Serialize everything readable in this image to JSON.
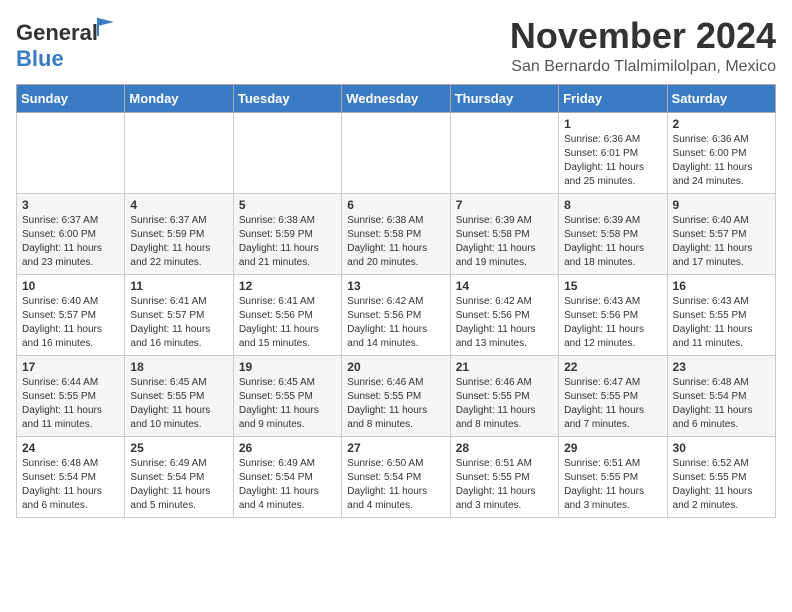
{
  "logo": {
    "general": "General",
    "blue": "Blue"
  },
  "title": "November 2024",
  "location": "San Bernardo Tlalmimilolpan, Mexico",
  "days_of_week": [
    "Sunday",
    "Monday",
    "Tuesday",
    "Wednesday",
    "Thursday",
    "Friday",
    "Saturday"
  ],
  "weeks": [
    [
      {
        "day": "",
        "info": ""
      },
      {
        "day": "",
        "info": ""
      },
      {
        "day": "",
        "info": ""
      },
      {
        "day": "",
        "info": ""
      },
      {
        "day": "",
        "info": ""
      },
      {
        "day": "1",
        "info": "Sunrise: 6:36 AM\nSunset: 6:01 PM\nDaylight: 11 hours and 25 minutes."
      },
      {
        "day": "2",
        "info": "Sunrise: 6:36 AM\nSunset: 6:00 PM\nDaylight: 11 hours and 24 minutes."
      }
    ],
    [
      {
        "day": "3",
        "info": "Sunrise: 6:37 AM\nSunset: 6:00 PM\nDaylight: 11 hours and 23 minutes."
      },
      {
        "day": "4",
        "info": "Sunrise: 6:37 AM\nSunset: 5:59 PM\nDaylight: 11 hours and 22 minutes."
      },
      {
        "day": "5",
        "info": "Sunrise: 6:38 AM\nSunset: 5:59 PM\nDaylight: 11 hours and 21 minutes."
      },
      {
        "day": "6",
        "info": "Sunrise: 6:38 AM\nSunset: 5:58 PM\nDaylight: 11 hours and 20 minutes."
      },
      {
        "day": "7",
        "info": "Sunrise: 6:39 AM\nSunset: 5:58 PM\nDaylight: 11 hours and 19 minutes."
      },
      {
        "day": "8",
        "info": "Sunrise: 6:39 AM\nSunset: 5:58 PM\nDaylight: 11 hours and 18 minutes."
      },
      {
        "day": "9",
        "info": "Sunrise: 6:40 AM\nSunset: 5:57 PM\nDaylight: 11 hours and 17 minutes."
      }
    ],
    [
      {
        "day": "10",
        "info": "Sunrise: 6:40 AM\nSunset: 5:57 PM\nDaylight: 11 hours and 16 minutes."
      },
      {
        "day": "11",
        "info": "Sunrise: 6:41 AM\nSunset: 5:57 PM\nDaylight: 11 hours and 16 minutes."
      },
      {
        "day": "12",
        "info": "Sunrise: 6:41 AM\nSunset: 5:56 PM\nDaylight: 11 hours and 15 minutes."
      },
      {
        "day": "13",
        "info": "Sunrise: 6:42 AM\nSunset: 5:56 PM\nDaylight: 11 hours and 14 minutes."
      },
      {
        "day": "14",
        "info": "Sunrise: 6:42 AM\nSunset: 5:56 PM\nDaylight: 11 hours and 13 minutes."
      },
      {
        "day": "15",
        "info": "Sunrise: 6:43 AM\nSunset: 5:56 PM\nDaylight: 11 hours and 12 minutes."
      },
      {
        "day": "16",
        "info": "Sunrise: 6:43 AM\nSunset: 5:55 PM\nDaylight: 11 hours and 11 minutes."
      }
    ],
    [
      {
        "day": "17",
        "info": "Sunrise: 6:44 AM\nSunset: 5:55 PM\nDaylight: 11 hours and 11 minutes."
      },
      {
        "day": "18",
        "info": "Sunrise: 6:45 AM\nSunset: 5:55 PM\nDaylight: 11 hours and 10 minutes."
      },
      {
        "day": "19",
        "info": "Sunrise: 6:45 AM\nSunset: 5:55 PM\nDaylight: 11 hours and 9 minutes."
      },
      {
        "day": "20",
        "info": "Sunrise: 6:46 AM\nSunset: 5:55 PM\nDaylight: 11 hours and 8 minutes."
      },
      {
        "day": "21",
        "info": "Sunrise: 6:46 AM\nSunset: 5:55 PM\nDaylight: 11 hours and 8 minutes."
      },
      {
        "day": "22",
        "info": "Sunrise: 6:47 AM\nSunset: 5:55 PM\nDaylight: 11 hours and 7 minutes."
      },
      {
        "day": "23",
        "info": "Sunrise: 6:48 AM\nSunset: 5:54 PM\nDaylight: 11 hours and 6 minutes."
      }
    ],
    [
      {
        "day": "24",
        "info": "Sunrise: 6:48 AM\nSunset: 5:54 PM\nDaylight: 11 hours and 6 minutes."
      },
      {
        "day": "25",
        "info": "Sunrise: 6:49 AM\nSunset: 5:54 PM\nDaylight: 11 hours and 5 minutes."
      },
      {
        "day": "26",
        "info": "Sunrise: 6:49 AM\nSunset: 5:54 PM\nDaylight: 11 hours and 4 minutes."
      },
      {
        "day": "27",
        "info": "Sunrise: 6:50 AM\nSunset: 5:54 PM\nDaylight: 11 hours and 4 minutes."
      },
      {
        "day": "28",
        "info": "Sunrise: 6:51 AM\nSunset: 5:55 PM\nDaylight: 11 hours and 3 minutes."
      },
      {
        "day": "29",
        "info": "Sunrise: 6:51 AM\nSunset: 5:55 PM\nDaylight: 11 hours and 3 minutes."
      },
      {
        "day": "30",
        "info": "Sunrise: 6:52 AM\nSunset: 5:55 PM\nDaylight: 11 hours and 2 minutes."
      }
    ]
  ]
}
